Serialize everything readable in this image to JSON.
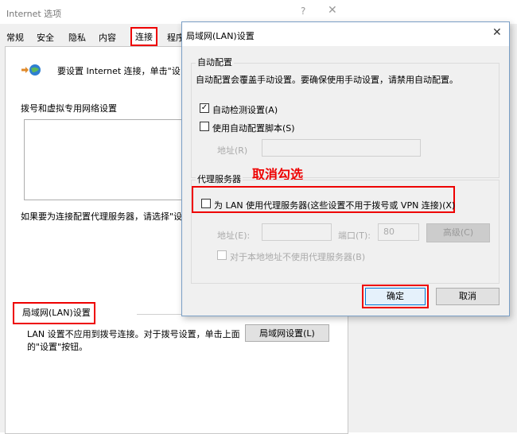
{
  "internet_options": {
    "title": "Internet 选项",
    "help_glyph": "?",
    "close_glyph": "✕",
    "tabs": [
      {
        "label": "常规"
      },
      {
        "label": "安全"
      },
      {
        "label": "隐私"
      },
      {
        "label": "内容"
      },
      {
        "label": "连接"
      },
      {
        "label": "程序"
      }
    ],
    "setup_text": "要设置 Internet 连接，单击\"设",
    "dialup_section_label": "拨号和虚拟专用网络设置",
    "proxy_hint": "如果要为连接配置代理服务器，请选择\"设",
    "lan_section_heading": "局域网(LAN)设置",
    "lan_description": "LAN 设置不应用到拨号连接。对于拨号设置，单击上面的\"设置\"按钮。",
    "lan_settings_button": "局域网设置(L)"
  },
  "lan_dialog": {
    "title": "局域网(LAN)设置",
    "close_glyph": "✕",
    "auto_config": {
      "group_title": "自动配置",
      "description": "自动配置会覆盖手动设置。要确保使用手动设置，请禁用自动配置。",
      "auto_detect_label": "自动检测设置(A)",
      "auto_detect_checked": true,
      "use_script_label": "使用自动配置脚本(S)",
      "use_script_checked": false,
      "address_label": "地址(R)",
      "address_value": ""
    },
    "annotation": "取消勾选",
    "proxy": {
      "group_title": "代理服务器",
      "use_proxy_label": "为 LAN 使用代理服务器(这些设置不用于拨号或 VPN 连接)(X)",
      "use_proxy_checked": false,
      "address_label": "地址(E):",
      "address_value": "",
      "port_label": "端口(T):",
      "port_value": "80",
      "advanced_button": "高级(C)",
      "bypass_local_label": "对于本地地址不使用代理服务器(B)",
      "bypass_local_checked": false
    },
    "ok_button": "确定",
    "cancel_button": "取消",
    "highlight_color": "#e00000"
  }
}
